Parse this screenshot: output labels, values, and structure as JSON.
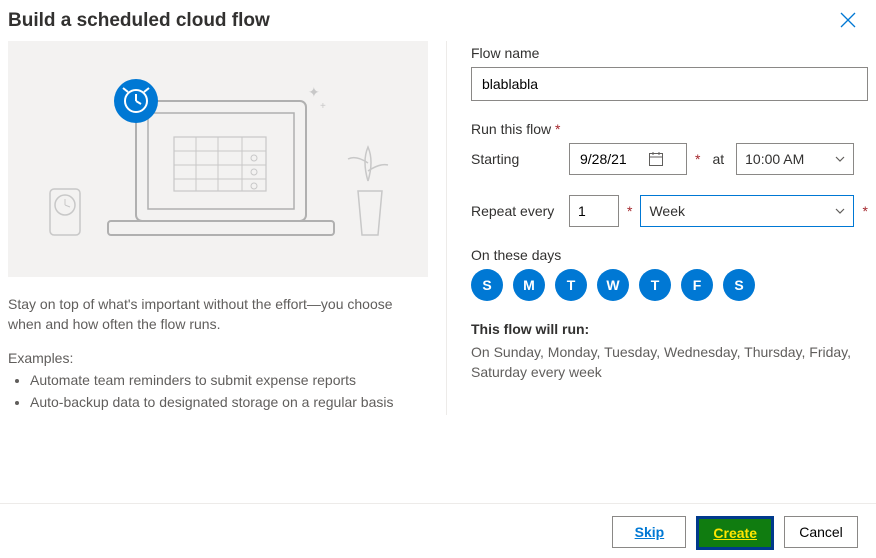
{
  "header": {
    "title": "Build a scheduled cloud flow"
  },
  "left": {
    "description": "Stay on top of what's important without the effort—you choose when and how often the flow runs.",
    "examples_label": "Examples:",
    "examples": [
      "Automate team reminders to submit expense reports",
      "Auto-backup data to designated storage on a regular basis"
    ]
  },
  "form": {
    "flow_name_label": "Flow name",
    "flow_name_value": "blablabla",
    "run_label": "Run this flow",
    "starting_label": "Starting",
    "date_value": "9/28/21",
    "at_label": "at",
    "time_value": "10:00 AM",
    "repeat_label": "Repeat every",
    "count_value": "1",
    "unit_value": "Week",
    "days_label": "On these days",
    "days": [
      "S",
      "M",
      "T",
      "W",
      "T",
      "F",
      "S"
    ],
    "summary_label": "This flow will run:",
    "summary_text": "On Sunday, Monday, Tuesday, Wednesday, Thursday, Friday, Saturday every week"
  },
  "footer": {
    "skip": "Skip",
    "create": "Create",
    "cancel": "Cancel"
  }
}
